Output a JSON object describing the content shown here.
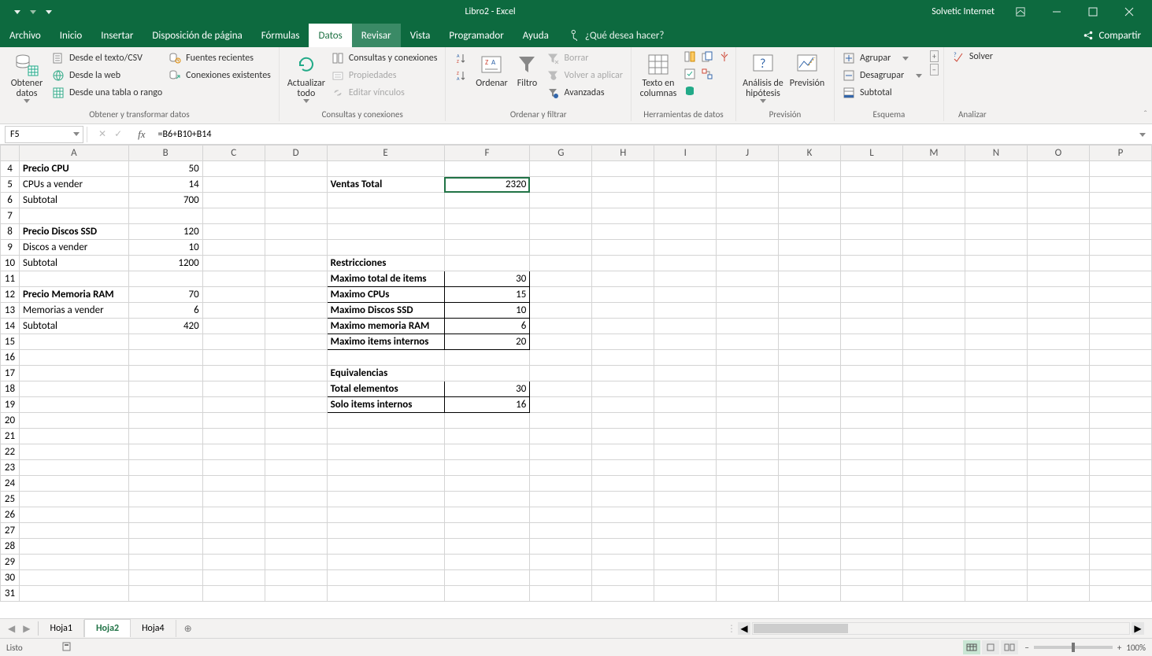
{
  "title": "Libro2 - Excel",
  "user": "Solvetic Internet",
  "menu": {
    "file": "Archivo",
    "home": "Inicio",
    "insert": "Insertar",
    "pagelayout": "Disposición de página",
    "formulas": "Fórmulas",
    "data": "Datos",
    "review": "Revisar",
    "view": "Vista",
    "developer": "Programador",
    "help": "Ayuda",
    "tell": "¿Qué desea hacer?",
    "share": "Compartir"
  },
  "ribbon": {
    "get_data": "Obtener\ndatos",
    "from_text": "Desde el texto/CSV",
    "from_web": "Desde la web",
    "from_table": "Desde una tabla o rango",
    "recent": "Fuentes recientes",
    "existing": "Conexiones existentes",
    "grp_get": "Obtener y transformar datos",
    "refresh": "Actualizar\ntodo",
    "queries": "Consultas y conexiones",
    "props": "Propiedades",
    "edit_links": "Editar vínculos",
    "grp_conn": "Consultas y conexiones",
    "sort": "Ordenar",
    "filter": "Filtro",
    "clear": "Borrar",
    "reapply": "Volver a aplicar",
    "advanced": "Avanzadas",
    "grp_sort": "Ordenar y filtrar",
    "text_cols": "Texto en\ncolumnas",
    "grp_tools": "Herramientas de datos",
    "whatif": "Análisis de\nhipótesis",
    "forecast": "Previsión",
    "grp_forecast": "Previsión",
    "group": "Agrupar",
    "ungroup": "Desagrupar",
    "subtotal": "Subtotal",
    "grp_outline": "Esquema",
    "solver": "Solver",
    "grp_analyze": "Analizar"
  },
  "namebox": "F5",
  "formula": "=B6+B10+B14",
  "cols": [
    "A",
    "B",
    "C",
    "D",
    "E",
    "F",
    "G",
    "H",
    "I",
    "J",
    "K",
    "L",
    "M",
    "N",
    "O",
    "P"
  ],
  "rows_start": 4,
  "rows_end": 31,
  "cells": {
    "A4": {
      "v": "Precio CPU",
      "b": true
    },
    "B4": {
      "v": "50",
      "n": true
    },
    "A5": {
      "v": "CPUs a vender"
    },
    "B5": {
      "v": "14",
      "n": true
    },
    "E5": {
      "v": "Ventas Total",
      "b": true
    },
    "F5": {
      "v": "2320",
      "n": true,
      "sel": true
    },
    "A6": {
      "v": "Subtotal"
    },
    "B6": {
      "v": "700",
      "n": true
    },
    "A8": {
      "v": "Precio Discos SSD",
      "b": true
    },
    "B8": {
      "v": "120",
      "n": true
    },
    "A9": {
      "v": "Discos  a vender"
    },
    "B9": {
      "v": "10",
      "n": true
    },
    "A10": {
      "v": "Subtotal"
    },
    "B10": {
      "v": "1200",
      "n": true
    },
    "E10": {
      "v": "Restricciones",
      "b": true
    },
    "E11": {
      "v": "Maximo total de items",
      "b": true,
      "box": true
    },
    "F11": {
      "v": "30",
      "n": true,
      "box": true
    },
    "A12": {
      "v": "Precio  Memoria RAM",
      "b": true
    },
    "B12": {
      "v": "70",
      "n": true
    },
    "E12": {
      "v": "Maximo CPUs",
      "b": true,
      "box": true
    },
    "F12": {
      "v": "15",
      "n": true,
      "box": true
    },
    "A13": {
      "v": "Memorias a vender"
    },
    "B13": {
      "v": "6",
      "n": true
    },
    "E13": {
      "v": "Maximo Discos SSD",
      "b": true,
      "box": true
    },
    "F13": {
      "v": "10",
      "n": true,
      "box": true
    },
    "A14": {
      "v": "Subtotal"
    },
    "B14": {
      "v": "420",
      "n": true
    },
    "E14": {
      "v": "Maximo memoria RAM",
      "b": true,
      "box": true
    },
    "F14": {
      "v": "6",
      "n": true,
      "box": true
    },
    "E15": {
      "v": "Maximo items internos",
      "b": true,
      "box": true
    },
    "F15": {
      "v": "20",
      "n": true,
      "box": true
    },
    "E17": {
      "v": "Equivalencias",
      "b": true
    },
    "E18": {
      "v": "Total elementos",
      "b": true,
      "box": true
    },
    "F18": {
      "v": "30",
      "n": true,
      "box": true
    },
    "E19": {
      "v": "Solo items internos",
      "b": true,
      "box": true
    },
    "F19": {
      "v": "16",
      "n": true,
      "box": true
    }
  },
  "sheets": {
    "s1": "Hoja1",
    "s2": "Hoja2",
    "s3": "Hoja4"
  },
  "status": "Listo",
  "zoom": "100%"
}
